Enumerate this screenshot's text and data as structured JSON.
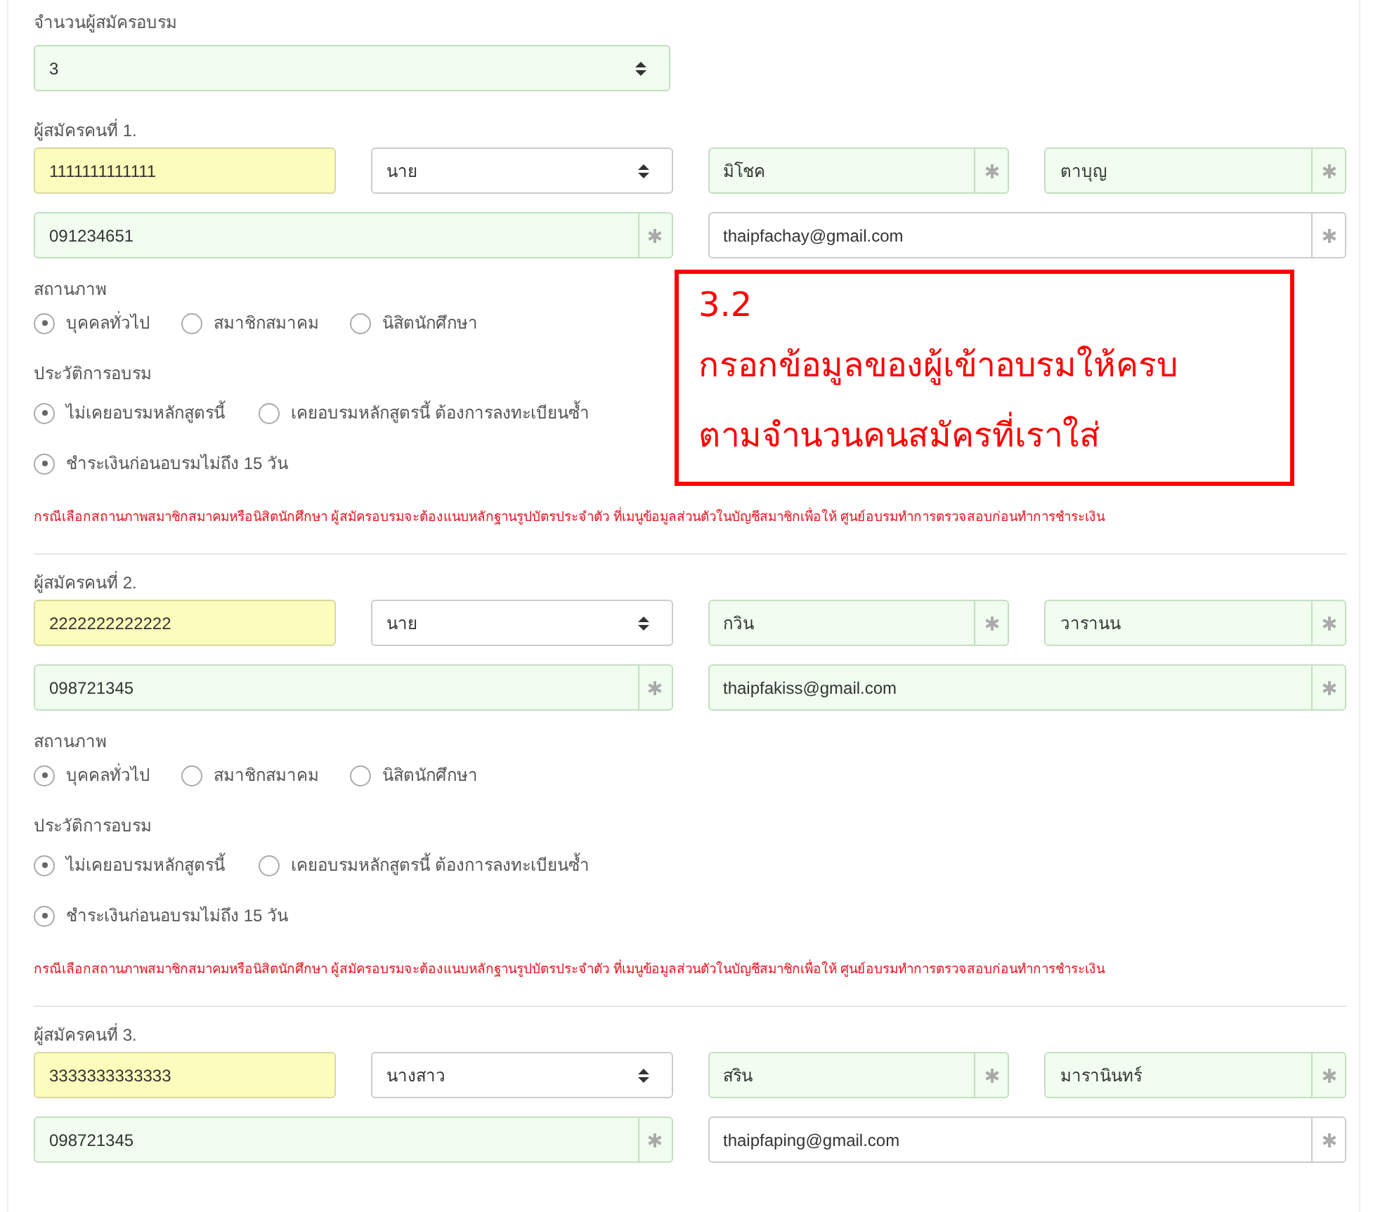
{
  "count_field": {
    "label": "จำนวนผู้สมัครอบรม",
    "value": "3"
  },
  "applicants": [
    {
      "heading": "ผู้สมัครคนที่ 1.",
      "fields": [
        {
          "kind": "text",
          "value": "1111111111111",
          "autofilled": true,
          "validated": false,
          "required": false
        },
        {
          "kind": "select",
          "value": "นาย",
          "autofilled": false,
          "validated": false,
          "required": false
        },
        {
          "kind": "text",
          "value": "มิโชค",
          "autofilled": false,
          "validated": true,
          "required": true
        },
        {
          "kind": "text",
          "value": "ตาบุญ",
          "autofilled": false,
          "validated": true,
          "required": true
        },
        {
          "kind": "text",
          "value": "091234651",
          "autofilled": false,
          "validated": true,
          "required": true
        },
        {
          "kind": "text",
          "value": "thaipfachay@gmail.com",
          "autofilled": false,
          "validated": false,
          "required": true
        }
      ],
      "status": {
        "label": "สถานภาพ",
        "options": [
          {
            "label": "บุคคลทั่วไป",
            "selected": true
          },
          {
            "label": "สมาชิกสมาคม",
            "selected": false
          },
          {
            "label": "นิสิตนักศึกษา",
            "selected": false
          }
        ]
      },
      "history": {
        "label": "ประวัติการอบรม",
        "options": [
          {
            "label": "ไม่เคยอบรมหลักสูตรนี้",
            "selected": true
          },
          {
            "label": "เคยอบรมหลักสูตรนี้ ต้องการลงทะเบียนซ้ำ",
            "selected": false
          }
        ],
        "extra": {
          "label": "ชำระเงินก่อนอบรมไม่ถึง 15 วัน",
          "selected": true
        }
      },
      "note": "กรณีเลือกสถานภาพสมาชิกสมาคมหรือนิสิตนักศึกษา ผู้สมัครอบรมจะต้องแนบหลักฐานรูปบัตรประจำตัว ที่เมนูข้อมูลส่วนตัวในบัญชีสมาชิกเพื่อให้ ศูนย์อบรมทำการตรวจสอบก่อนทำการชำระเงิน"
    },
    {
      "heading": "ผู้สมัครคนที่ 2.",
      "fields": [
        {
          "kind": "text",
          "value": "2222222222222",
          "autofilled": true,
          "validated": false,
          "required": false
        },
        {
          "kind": "select",
          "value": "นาย",
          "autofilled": false,
          "validated": false,
          "required": false
        },
        {
          "kind": "text",
          "value": "กวิน",
          "autofilled": false,
          "validated": true,
          "required": true
        },
        {
          "kind": "text",
          "value": "วารานน",
          "autofilled": false,
          "validated": true,
          "required": true
        },
        {
          "kind": "text",
          "value": "098721345",
          "autofilled": false,
          "validated": true,
          "required": true
        },
        {
          "kind": "text",
          "value": "thaipfakiss@gmail.com",
          "autofilled": false,
          "validated": true,
          "required": true
        }
      ],
      "status": {
        "label": "สถานภาพ",
        "options": [
          {
            "label": "บุคคลทั่วไป",
            "selected": true
          },
          {
            "label": "สมาชิกสมาคม",
            "selected": false
          },
          {
            "label": "นิสิตนักศึกษา",
            "selected": false
          }
        ]
      },
      "history": {
        "label": "ประวัติการอบรม",
        "options": [
          {
            "label": "ไม่เคยอบรมหลักสูตรนี้",
            "selected": true
          },
          {
            "label": "เคยอบรมหลักสูตรนี้ ต้องการลงทะเบียนซ้ำ",
            "selected": false
          }
        ],
        "extra": {
          "label": "ชำระเงินก่อนอบรมไม่ถึง 15 วัน",
          "selected": true
        }
      },
      "note": "กรณีเลือกสถานภาพสมาชิกสมาคมหรือนิสิตนักศึกษา ผู้สมัครอบรมจะต้องแนบหลักฐานรูปบัตรประจำตัว ที่เมนูข้อมูลส่วนตัวในบัญชีสมาชิกเพื่อให้ ศูนย์อบรมทำการตรวจสอบก่อนทำการชำระเงิน"
    },
    {
      "heading": "ผู้สมัครคนที่ 3.",
      "fields": [
        {
          "kind": "text",
          "value": "3333333333333",
          "autofilled": true,
          "validated": false,
          "required": false
        },
        {
          "kind": "select",
          "value": "นางสาว",
          "autofilled": false,
          "validated": false,
          "required": false
        },
        {
          "kind": "text",
          "value": "สริน",
          "autofilled": false,
          "validated": true,
          "required": true
        },
        {
          "kind": "text",
          "value": "มารานินทร์",
          "autofilled": false,
          "validated": true,
          "required": true
        },
        {
          "kind": "text",
          "value": "098721345",
          "autofilled": false,
          "validated": true,
          "required": true
        },
        {
          "kind": "text",
          "value": "thaipfaping@gmail.com",
          "autofilled": false,
          "validated": false,
          "required": true
        }
      ]
    }
  ],
  "callout": {
    "step": "3.2",
    "lines": [
      "กรอกข้อมูลของผู้เข้าอบรมให้ครบ",
      "ตามจำนวนคนสมัครที่เราใส่"
    ]
  }
}
